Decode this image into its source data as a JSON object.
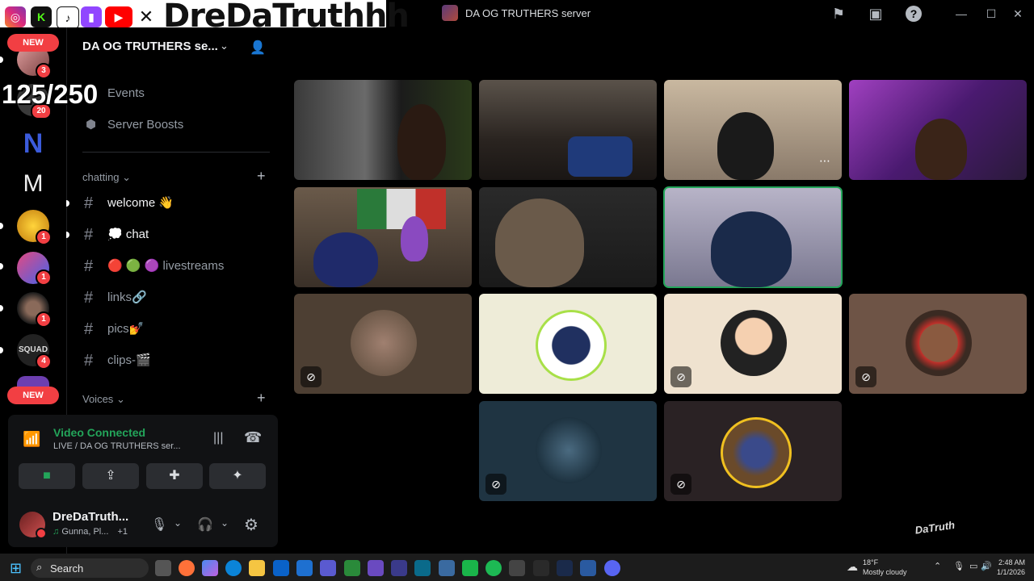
{
  "window": {
    "title": "DA OG TRUTHERS server",
    "controls": [
      "minimize-icon",
      "maximize-icon",
      "close-icon"
    ]
  },
  "stream_overlay": {
    "social_icons": [
      "instagram-icon",
      "kick-icon",
      "tiktok-icon",
      "twitch-icon",
      "youtube-icon",
      "x-icon"
    ],
    "name": "DreDaTruthhh",
    "counter": "125/250",
    "corner_logo": "DaTruth"
  },
  "rail": {
    "new_top": "NEW",
    "new_bottom": "NEW",
    "badges": [
      "3",
      "20",
      "1",
      "1",
      "1",
      "4"
    ]
  },
  "sidebar": {
    "server_name": "DA OG TRUTHERS se...",
    "items": [
      {
        "label": "Events",
        "icon": "calendar-icon"
      },
      {
        "label": "Server Boosts",
        "icon": "boost-icon"
      }
    ],
    "category_chatting": "chatting",
    "channels": [
      {
        "name": "welcome 👋",
        "unread": true
      },
      {
        "name": "💭 chat",
        "unread": true
      },
      {
        "name": "🔴 🟢 🟣 livestreams",
        "unread": false
      },
      {
        "name": "links🔗",
        "unread": false
      },
      {
        "name": "pics💅",
        "unread": false
      },
      {
        "name": "clips-🎬",
        "unread": false
      }
    ],
    "category_voices": "Voices"
  },
  "voice": {
    "status": "Video Connected",
    "channel": "LIVE / DA OG TRUTHERS ser...",
    "buttons": [
      "camera-icon",
      "screen-share-icon",
      "activities-icon",
      "soundboard-icon"
    ]
  },
  "user": {
    "name": "DreDaTruth...",
    "activity": "Gunna, Pl...",
    "activity_extra": "+1"
  },
  "grid": {
    "tiles": [
      {
        "kind": "video",
        "speaking": false
      },
      {
        "kind": "video",
        "speaking": false
      },
      {
        "kind": "video",
        "speaking": false
      },
      {
        "kind": "video",
        "speaking": false
      },
      {
        "kind": "video",
        "speaking": false
      },
      {
        "kind": "video",
        "speaking": false
      },
      {
        "kind": "video",
        "speaking": true
      },
      {
        "kind": "avatar",
        "bg": "#4d3f33",
        "muted": "deafened"
      },
      {
        "kind": "avatar",
        "bg": "#eeecd8",
        "muted": "none"
      },
      {
        "kind": "avatar",
        "bg": "#efe2cf",
        "muted": "deafened"
      },
      {
        "kind": "avatar",
        "bg": "#6e5446",
        "muted": "muted"
      },
      {
        "kind": "avatar",
        "bg": "#1f3442",
        "muted": "muted"
      },
      {
        "kind": "avatar",
        "bg": "#2a2224",
        "muted": "deafened"
      }
    ]
  },
  "taskbar": {
    "search_label": "Search",
    "weather_temp": "18°F",
    "weather_condition": "Mostly cloudy",
    "time": "2:48 AM",
    "date": "1/1/2026"
  }
}
